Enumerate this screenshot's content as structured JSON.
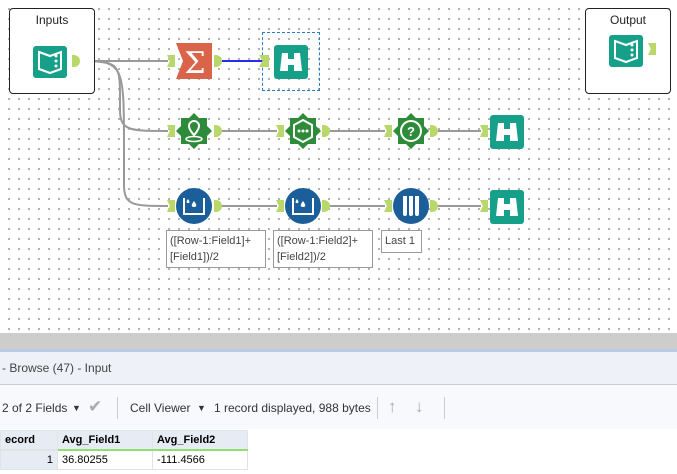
{
  "canvas": {
    "containers": [
      {
        "title": "Inputs"
      },
      {
        "title": "Output"
      }
    ],
    "annotations": [
      "([Row-1:Field1]+ [Field1])/2",
      "([Row-1:Field2]+ [Field2])/2",
      "Last 1"
    ]
  },
  "panel": {
    "title": "- Browse (47) - Input",
    "fields_selector": "2 of 2 Fields",
    "cell_viewer": "Cell Viewer",
    "status": "1 record displayed, 988 bytes",
    "columns": [
      "ecord",
      "Avg_Field1",
      "Avg_Field2"
    ],
    "rows": [
      [
        "1",
        "36.80255",
        "-111.4566"
      ]
    ]
  },
  "colors": {
    "browse": "#16a08a",
    "summarize": "#d9644a",
    "spatial": "#2e8b3a",
    "preparation": "#1c5e9a",
    "anchor": "#b8d86a",
    "selected_connection": "#2a2af0"
  }
}
